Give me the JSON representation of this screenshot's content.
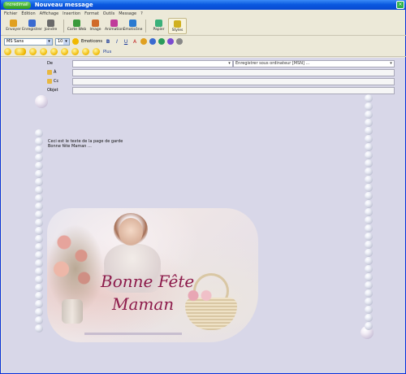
{
  "window": {
    "app_badge": "Incredimail",
    "title": "Nouveau message",
    "close_glyph": "×"
  },
  "menu": [
    "Fichier",
    "Édition",
    "Affichage",
    "Insertion",
    "Format",
    "Outils",
    "Message",
    "?"
  ],
  "toolbar": [
    {
      "label": "Envoyer",
      "icon": "send-icon",
      "color": "#e0a020"
    },
    {
      "label": "Enregistrer",
      "icon": "save-icon",
      "color": "#3a6ad0"
    },
    {
      "label": "Joindre",
      "icon": "attach-icon",
      "color": "#6a6a6a"
    },
    {
      "label": "Carte Web",
      "icon": "ecard-icon",
      "color": "#3a9a3a"
    },
    {
      "label": "Image",
      "icon": "image-icon",
      "color": "#d06a2a"
    },
    {
      "label": "Animation",
      "icon": "animation-icon",
      "color": "#c03a9a"
    },
    {
      "label": "Emoticône",
      "icon": "emoticon-icon",
      "color": "#2a7ad0"
    },
    {
      "label": "Papier",
      "icon": "stationery-icon",
      "color": "#3ab07a"
    },
    {
      "label": "Styles",
      "icon": "styles-icon",
      "color": "#d0b020"
    }
  ],
  "format": {
    "font": "MS Sans",
    "size": "10",
    "emoticons_label": "Emoticons",
    "bold": "B",
    "italic": "I",
    "underline": "U",
    "color": "A",
    "plus": "Plus"
  },
  "header": {
    "from_label": "De",
    "from_value": "Enregistrer sous ordinateur [MSN] ...",
    "to_label": "À",
    "cc_label": "Cc",
    "subject_label": "Objet"
  },
  "message_lines": [
    "Ceci est le texte de la page de garde",
    "Bonne fête Maman ..."
  ],
  "card": {
    "line1": "Bonne Fête",
    "line2": "Maman"
  },
  "colors": {
    "titlebar": "#0a5ae0",
    "compose_bg": "#d8d7e8",
    "card_text": "#8c1a4a"
  }
}
